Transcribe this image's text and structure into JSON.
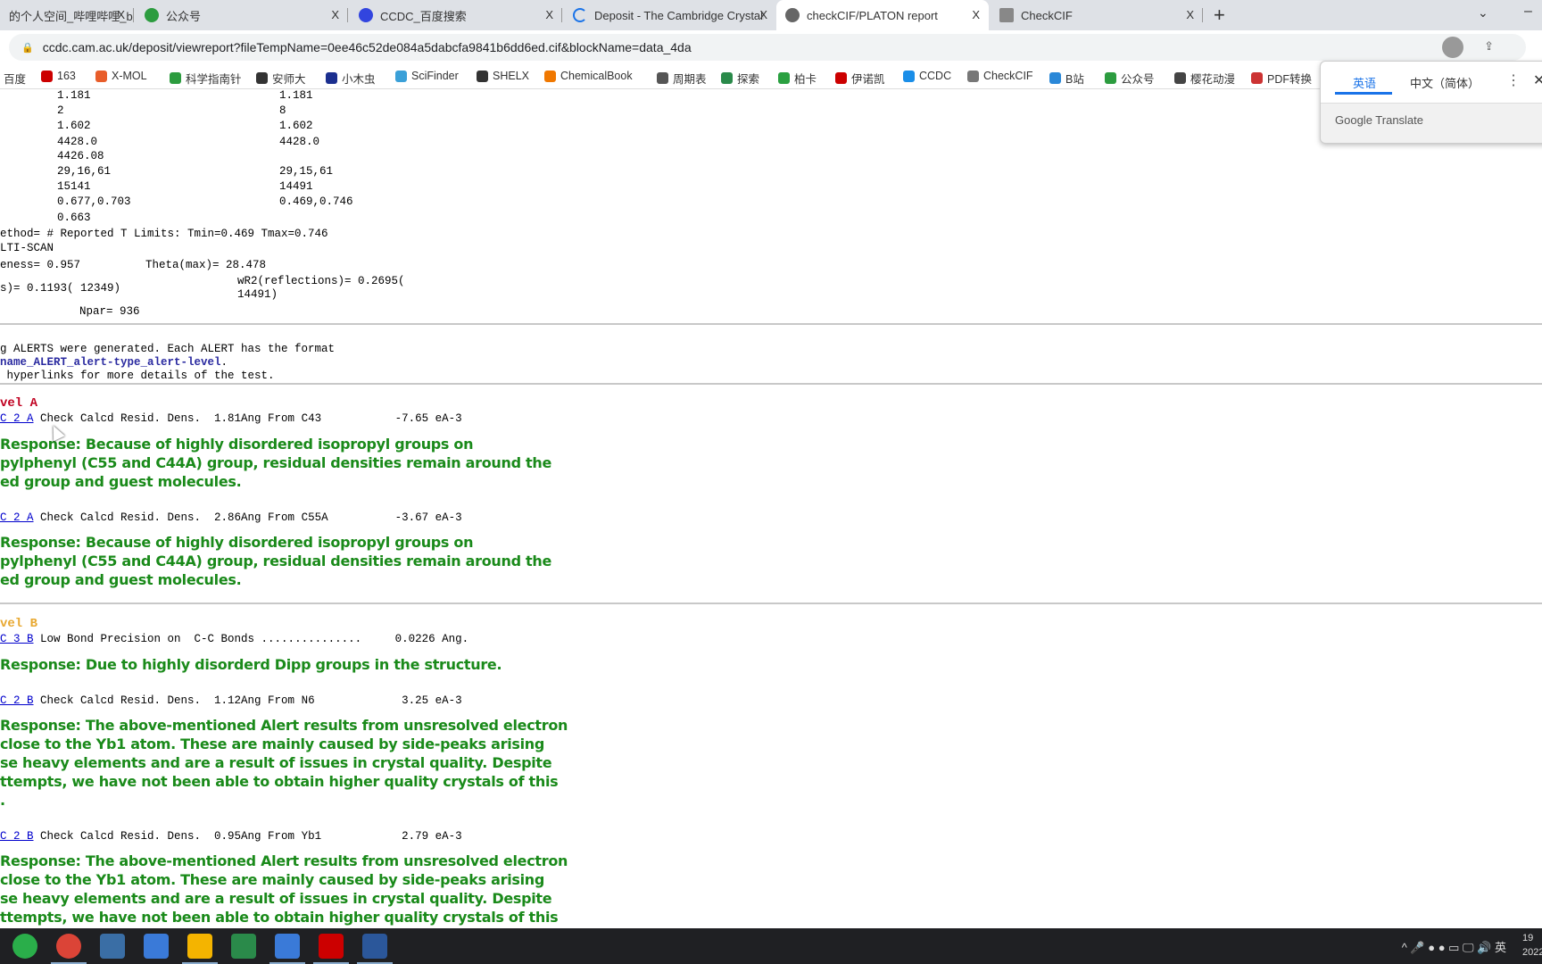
{
  "tabs": [
    {
      "title": "的个人空间_哔哩哔哩_b",
      "close": "X"
    },
    {
      "title": "公众号",
      "close": "X"
    },
    {
      "title": "CCDC_百度搜索",
      "close": "X"
    },
    {
      "title": "Deposit - The Cambridge Crystallographic",
      "close": "X"
    },
    {
      "title": "checkCIF/PLATON report",
      "close": "X"
    },
    {
      "title": "CheckCIF",
      "close": "X"
    }
  ],
  "new_tab": "+",
  "url": "ccdc.cam.ac.uk/deposit/viewreport?fileTempName=0ee46c52de084a5dabcfa9841b6dd6ed.cif&blockName=data_4da",
  "bookmarks": [
    "百度",
    "163",
    "X-MOL",
    "科学指南针",
    "安师大",
    "小木虫",
    "SciFinder",
    "SHELX",
    "ChemicalBook",
    "周期表",
    "探索",
    "柏卡",
    "伊诺凯",
    "CCDC",
    "CheckCIF",
    "B站",
    "公众号",
    "樱花动漫",
    "PDF转换"
  ],
  "translate": {
    "source": "英语",
    "target": "中文（简体）",
    "brand": "Google Translate",
    "more": "⋮",
    "close": "✕"
  },
  "summary": [
    {
      "left": "1.181",
      "right": "1.181"
    },
    {
      "left": "2",
      "right": "8"
    },
    {
      "left": "1.602",
      "right": "1.602"
    },
    {
      "left": "4428.0",
      "right": "4428.0"
    },
    {
      "left": "4426.08",
      "right": ""
    },
    {
      "left": "29,16,61",
      "right": "29,15,61"
    },
    {
      "left": "15141",
      "right": "14491"
    },
    {
      "left": "0.677,0.703",
      "right": "0.469,0.746"
    },
    {
      "left": "0.663",
      "right": ""
    }
  ],
  "correction": "ethod= # Reported T Limits: Tmin=0.469 Tmax=0.746",
  "correction2": "LTI-SCAN",
  "completeness": "eness= 0.957",
  "theta": "Theta(max)= 28.478",
  "r1": "s)= 0.1193( 12349)",
  "wr2_a": "wR2(reflections)= 0.2695(",
  "wr2_b": "14491)",
  "npar": "Npar= 936",
  "intro": {
    "l1": "g ALERTS were generated. Each ALERT has the format",
    "l2": "name_ALERT_alert-type_alert-level",
    "l2end": ".",
    "l3": " hyperlinks for more details of the test."
  },
  "levelA": "vel A",
  "levelB": "vel B",
  "alerts": [
    {
      "code": "C 2 A",
      "text": " Check Calcd Resid. Dens.  1.81Ang From C43           -7.65 eA-3",
      "response": [
        "Response: Because of highly disordered isopropyl groups on",
        "pylphenyl (C55 and C44A) group, residual densities remain around the",
        "ed group and guest molecules."
      ]
    },
    {
      "code": "C 2 A",
      "text": " Check Calcd Resid. Dens.  2.86Ang From C55A          -3.67 eA-3",
      "response": [
        "Response: Because of highly disordered isopropyl groups on",
        "pylphenyl (C55 and C44A) group, residual densities remain around the",
        "ed group and guest molecules."
      ]
    },
    {
      "code": "C 3 B",
      "text": " Low Bond Precision on  C-C Bonds ...............     0.0226 Ang.",
      "response": [
        "Response: Due to highly disorderd Dipp groups in the structure."
      ]
    },
    {
      "code": "C 2 B",
      "text": " Check Calcd Resid. Dens.  1.12Ang From N6             3.25 eA-3",
      "response": [
        "Response: The above-mentioned Alert results from unsresolved electron",
        "close to the Yb1 atom. These are mainly caused by side-peaks arising",
        "se heavy elements and are a result of issues in crystal quality. Despite",
        "ttempts, we have not been able to obtain higher quality crystals of this",
        "."
      ]
    },
    {
      "code": "C 2 B",
      "text": " Check Calcd Resid. Dens.  0.95Ang From Yb1            2.79 eA-3",
      "response": [
        "Response: The above-mentioned Alert results from unsresolved electron",
        "close to the Yb1 atom. These are mainly caused by side-peaks arising",
        "se heavy elements and are a result of issues in crystal quality. Despite",
        "ttempts, we have not been able to obtain higher quality crystals of this"
      ]
    }
  ],
  "taskbar": {
    "apps": [
      "wechat",
      "chrome",
      "calculator",
      "app",
      "file-explorer",
      "chemdraw",
      "app2",
      "acrobat",
      "word"
    ],
    "tray": "^ 🎤 ● ● ▭ 🖵 🔊 英",
    "clock": "19 2022"
  },
  "colors": {
    "response": "#1a8a1a",
    "levelA": "#c00020",
    "levelB": "#e8a830",
    "link": "#0000cc"
  }
}
